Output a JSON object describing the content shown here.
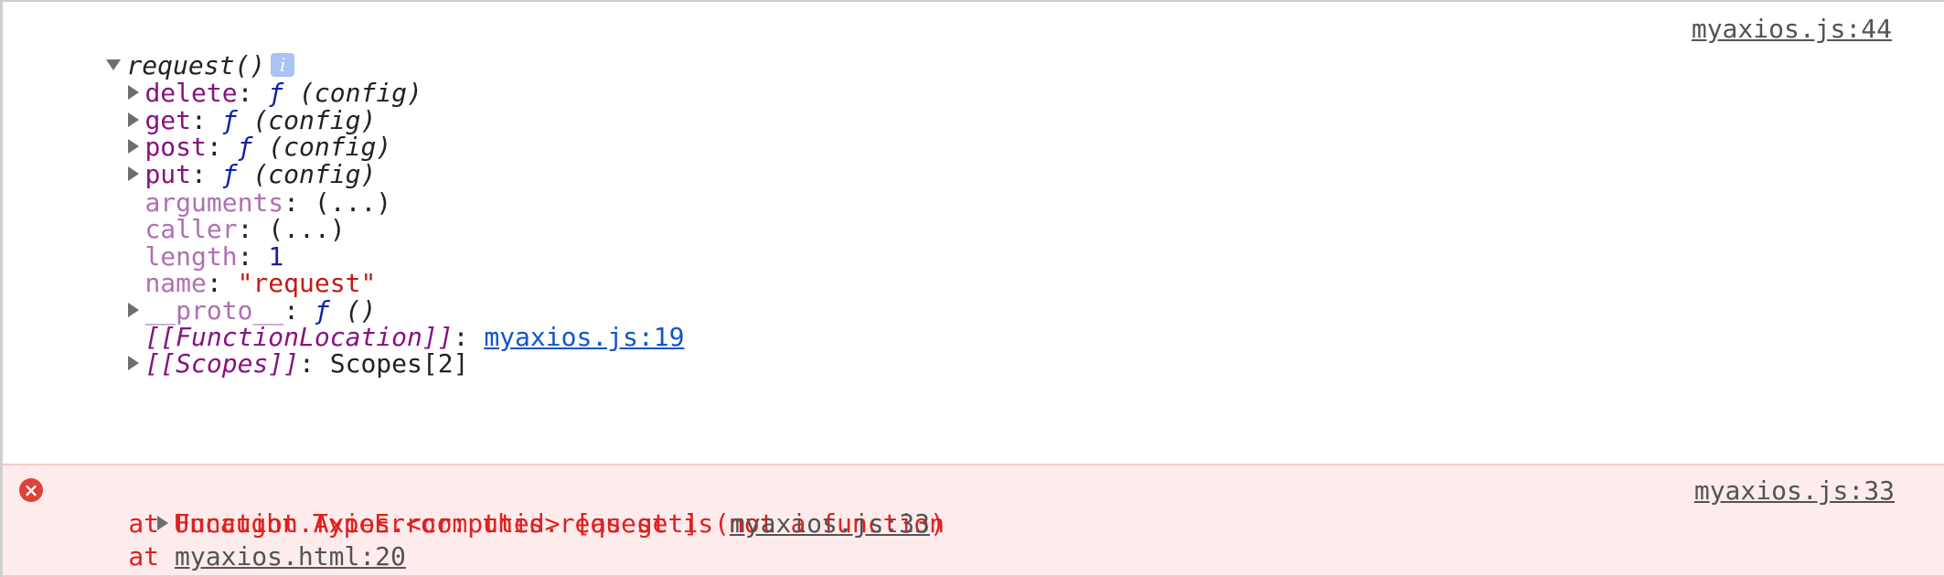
{
  "log": {
    "header": {
      "name": "request()",
      "info": "i",
      "source": "myaxios.js:44"
    },
    "methods": [
      {
        "key": "delete",
        "sep": ": ",
        "f": "ƒ",
        "sig": " (config)"
      },
      {
        "key": "get",
        "sep": ": ",
        "f": "ƒ",
        "sig": " (config)"
      },
      {
        "key": "post",
        "sep": ": ",
        "f": "ƒ",
        "sig": " (config)"
      },
      {
        "key": "put",
        "sep": ": ",
        "f": "ƒ",
        "sig": " (config)"
      }
    ],
    "props": {
      "arguments": {
        "key": "arguments",
        "value": ": (...)"
      },
      "caller": {
        "key": "caller",
        "value": ": (...)"
      },
      "length": {
        "key": "length",
        "sep": ": ",
        "value": "1"
      },
      "name": {
        "key": "name",
        "sep": ": ",
        "value": "\"request\""
      },
      "proto": {
        "key": "__proto__",
        "sep": ": ",
        "f": "ƒ",
        "sig": " ()"
      },
      "function_location": {
        "key": "[[FunctionLocation]]",
        "sep": ": ",
        "link": "myaxios.js:19"
      },
      "scopes": {
        "key": "[[Scopes]]",
        "value": ": Scopes[2]"
      }
    }
  },
  "error": {
    "icon": "×",
    "message": "Uncaught TypeError: this.request is not a function",
    "source": "myaxios.js:33",
    "stack1_prefix": "    at Function.Axios.<computed> [as get] (",
    "stack1_link": "myaxios.js:33",
    "stack1_suffix": ")",
    "stack2_prefix": "    at ",
    "stack2_link": "myaxios.html:20"
  }
}
